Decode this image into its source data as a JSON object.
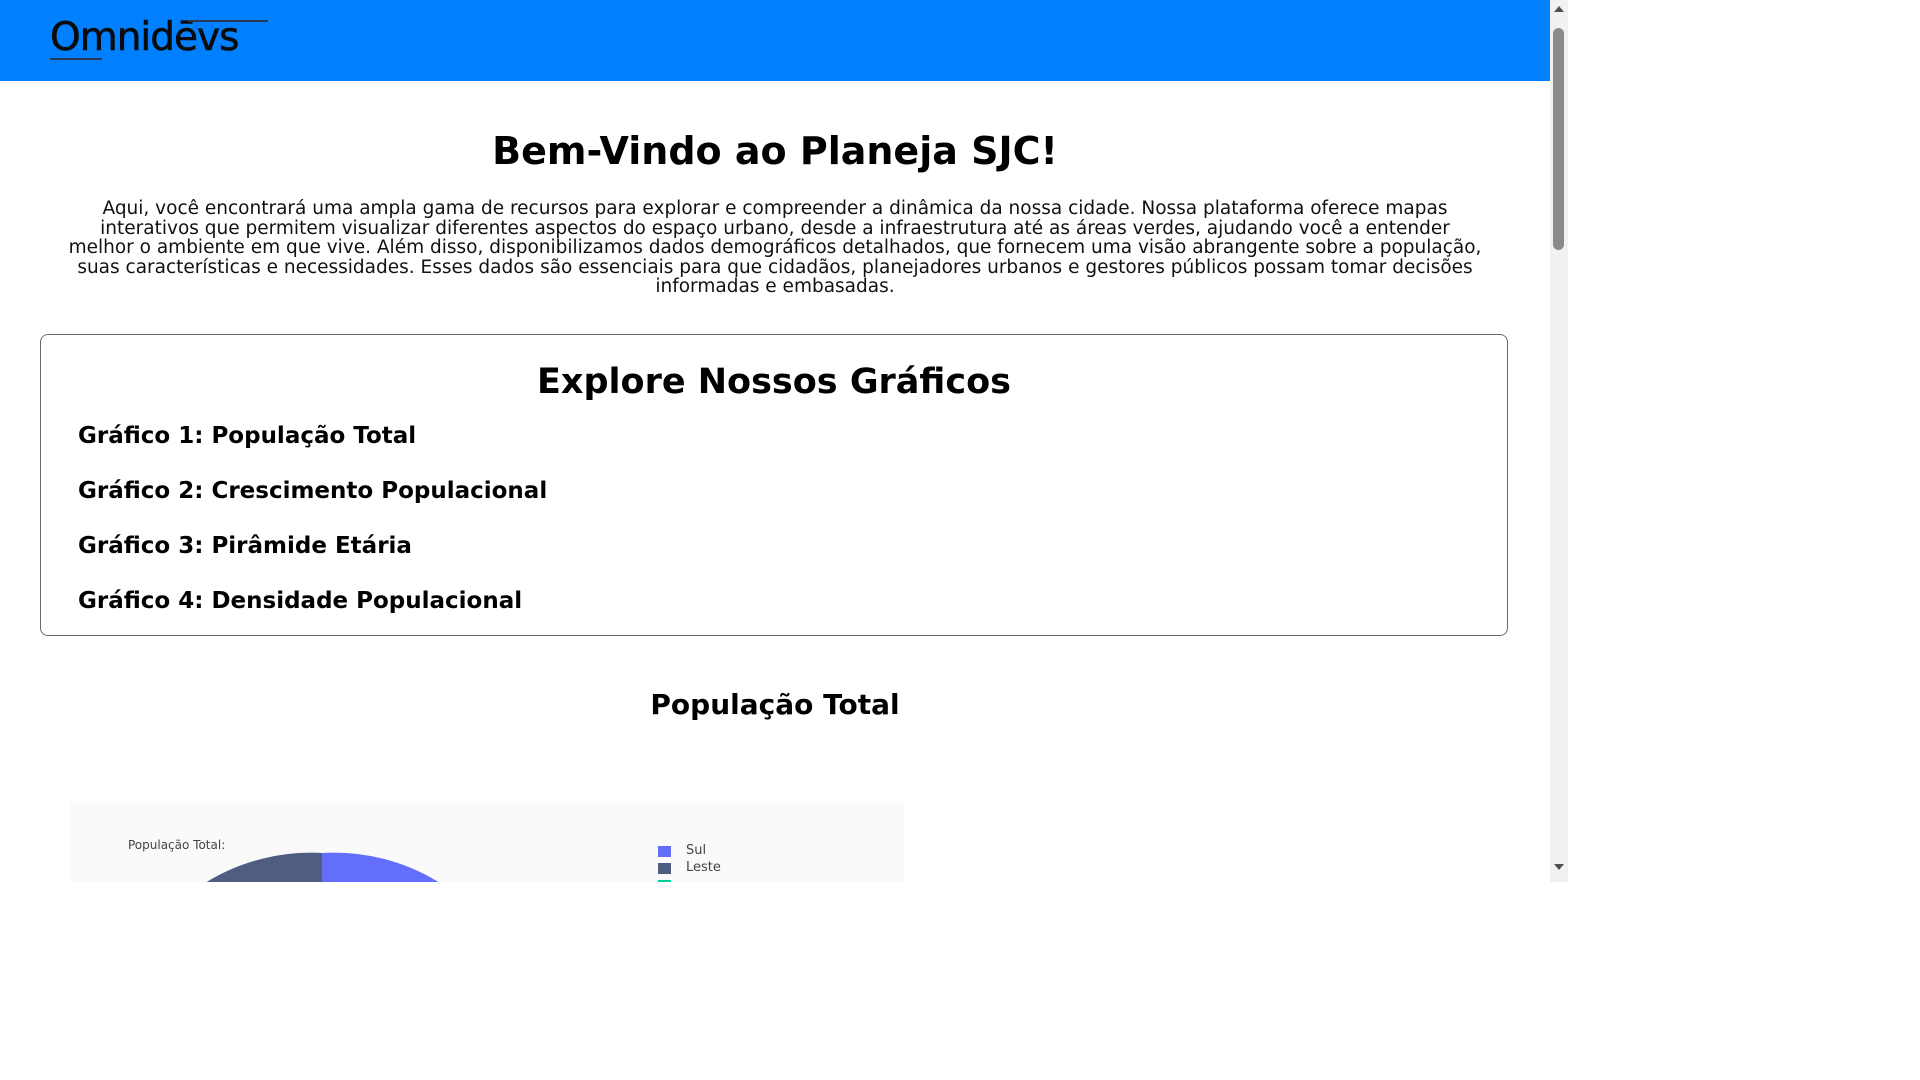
{
  "header": {
    "logo_text": "Omnidēvs",
    "background_color": "#0080ff"
  },
  "welcome": {
    "title": "Bem-Vindo ao Planeja SJC!",
    "text": "Aqui, você encontrará uma ampla gama de recursos para explorar e compreender a dinâmica da nossa cidade. Nossa plataforma oferece mapas interativos que permitem visualizar diferentes aspectos do espaço urbano, desde a infraestrutura até as áreas verdes, ajudando você a entender melhor o ambiente em que vive. Além disso, disponibilizamos dados demográficos detalhados, que fornecem uma visão abrangente sobre a população, suas características e necessidades. Esses dados são essenciais para que cidadãos, planejadores urbanos e gestores públicos possam tomar decisões informadas e embasadas."
  },
  "graphs": {
    "title": "Explore Nossos Gráficos",
    "items": [
      {
        "label": "Gráfico 1: População Total"
      },
      {
        "label": "Gráfico 2: Crescimento Populacional"
      },
      {
        "label": "Gráfico 3: Pirâmide Etária"
      },
      {
        "label": "Gráfico 4: Densidade Populacional"
      }
    ]
  },
  "section": {
    "title": "População Total"
  },
  "chart": {
    "label": "População Total:",
    "legend": [
      {
        "name": "Sul",
        "color": "#636efa"
      },
      {
        "name": "Leste",
        "color": "#4f5d82"
      },
      {
        "name": "",
        "color": "#00cc96"
      }
    ]
  }
}
